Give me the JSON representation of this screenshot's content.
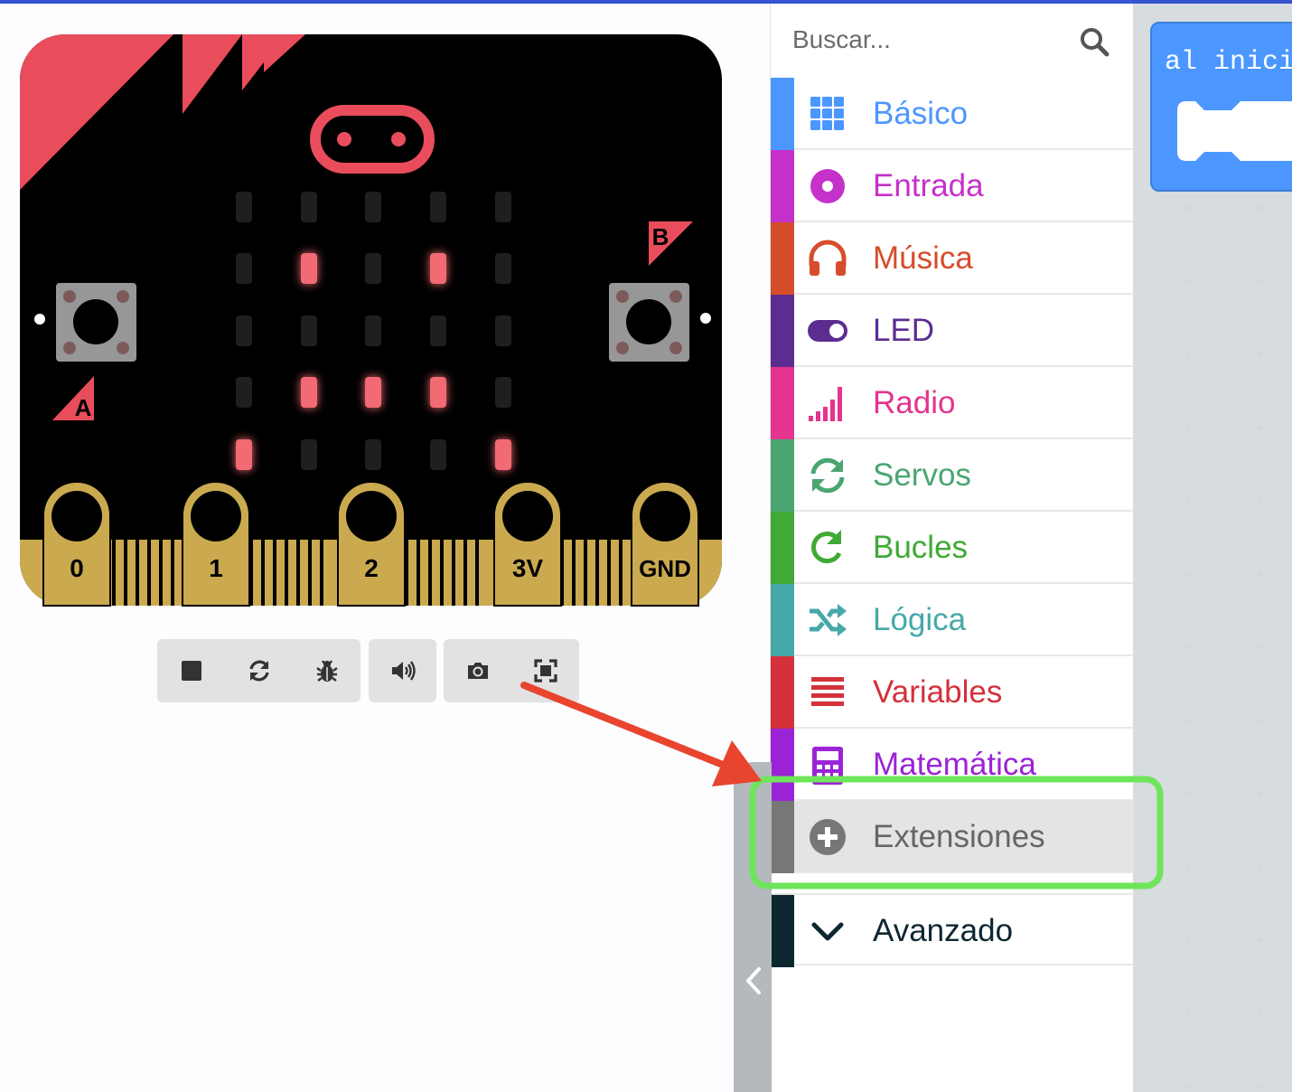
{
  "simulator": {
    "button_a_label": "A",
    "button_b_label": "B",
    "pins": [
      "0",
      "1",
      "2",
      "3V",
      "GND"
    ],
    "led_matrix_on": [
      [
        0,
        0,
        0,
        0,
        0
      ],
      [
        0,
        1,
        0,
        1,
        0
      ],
      [
        0,
        0,
        0,
        0,
        0
      ],
      [
        0,
        1,
        1,
        1,
        0
      ],
      [
        1,
        0,
        0,
        0,
        1
      ]
    ],
    "toolbar_icons": [
      "stop-icon",
      "restart-icon",
      "debug-icon",
      "sound-icon",
      "screenshot-icon",
      "fullscreen-icon"
    ]
  },
  "toolbox": {
    "search_placeholder": "Buscar...",
    "categories": [
      {
        "label": "Básico",
        "color": "#4c97ff",
        "icon": "grid-icon"
      },
      {
        "label": "Entrada",
        "color": "#c531cb",
        "icon": "target-icon"
      },
      {
        "label": "Música",
        "color": "#d64d2c",
        "icon": "headphones-icon"
      },
      {
        "label": "LED",
        "color": "#5c2d91",
        "icon": "toggle-icon"
      },
      {
        "label": "Radio",
        "color": "#e3348f",
        "icon": "signal-bars-icon"
      },
      {
        "label": "Servos",
        "color": "#4aa572",
        "icon": "refresh-icon"
      },
      {
        "label": "Bucles",
        "color": "#3faa35",
        "icon": "loop-icon"
      },
      {
        "label": "Lógica",
        "color": "#46a8a8",
        "icon": "shuffle-icon"
      },
      {
        "label": "Variables",
        "color": "#d4313b",
        "icon": "list-icon"
      },
      {
        "label": "Matemática",
        "color": "#9b23d6",
        "icon": "calculator-icon"
      },
      {
        "label": "Extensiones",
        "color": "#777777",
        "icon": "plus-circle-icon"
      },
      {
        "label": "Avanzado",
        "color": "#0d2731",
        "icon": "chevron-down-icon"
      }
    ]
  },
  "workspace": {
    "block_label": "al inicio"
  },
  "annotations": {
    "highlight_color": "#6ee55a",
    "arrow_color": "#e8442e"
  }
}
